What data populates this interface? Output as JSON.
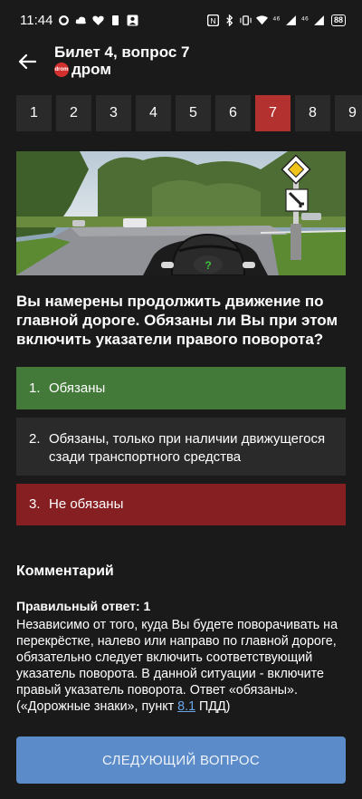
{
  "status_bar": {
    "time": "11:44",
    "right_text_1": "⁴⁶",
    "right_text_2": "⁴⁶",
    "battery": "88"
  },
  "header": {
    "title": "Билет 4, вопрос 7",
    "source_name": "дром",
    "logo_text": "drom"
  },
  "question_nav": {
    "items": [
      "1",
      "2",
      "3",
      "4",
      "5",
      "6",
      "7",
      "8",
      "9"
    ],
    "active": "7"
  },
  "question": {
    "text": "Вы намерены продолжить движение по главной дороге. Обязаны ли Вы при этом включить указатели правого поворота?"
  },
  "answers": [
    {
      "num": "1.",
      "text": "Обязаны",
      "state": "correct"
    },
    {
      "num": "2.",
      "text": "Обязаны, только при наличии движущегося сзади транспортного средства",
      "state": "neutral"
    },
    {
      "num": "3.",
      "text": "Не обязаны",
      "state": "wrong"
    }
  ],
  "comment": {
    "title": "Комментарий",
    "correct_label": "Правильный ответ: 1",
    "body_before_link": "Независимо от того, куда Вы будете поворачивать на перекрёстке, налево или направо по главной дороге, обязательно следует включить соответствующий указатель поворота. В данной ситуации - включите правый указатель поворота. Ответ «обязаны». («Дорожные знаки», пункт ",
    "link_text": "8.1",
    "body_after_link": " ПДД)"
  },
  "next_button": {
    "label": "СЛЕДУЮЩИЙ ВОПРОС"
  },
  "colors": {
    "background": "#1a1a1a",
    "correct": "#437a3a",
    "wrong": "#861f22",
    "active_tab": "#b3312e",
    "button": "#5b8bc9",
    "link": "#6aa6e8"
  }
}
